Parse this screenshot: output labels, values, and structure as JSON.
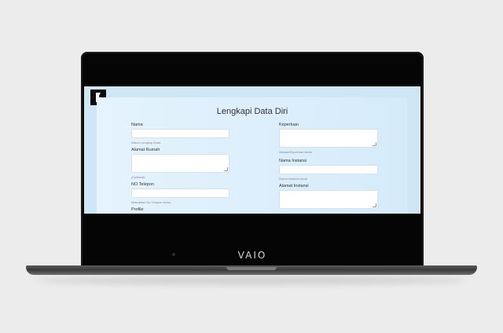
{
  "device": {
    "brand_label": "VAIO"
  },
  "form": {
    "title": "Lengkapi Data Diri",
    "left_fields": [
      {
        "label": "Nama",
        "hint": "Nama Lengkap Anda"
      },
      {
        "label": "Alamat Rumah",
        "hint": "(Optional)"
      },
      {
        "label": "NO Telepon",
        "hint": "Masukkan No Telepon Anda"
      },
      {
        "label": "Profile"
      }
    ],
    "right_fields": [
      {
        "label": "Keperluan",
        "hint": "Alasan/Keperluan Anda"
      },
      {
        "label": "Nama Instansi",
        "hint": "Nama Instansi Anda"
      },
      {
        "label": "Alamat Instansi"
      }
    ]
  },
  "colors": {
    "screen_bg": "#cfe6f6",
    "card_bg": "#e5f3fd",
    "bezel": "#050505"
  }
}
